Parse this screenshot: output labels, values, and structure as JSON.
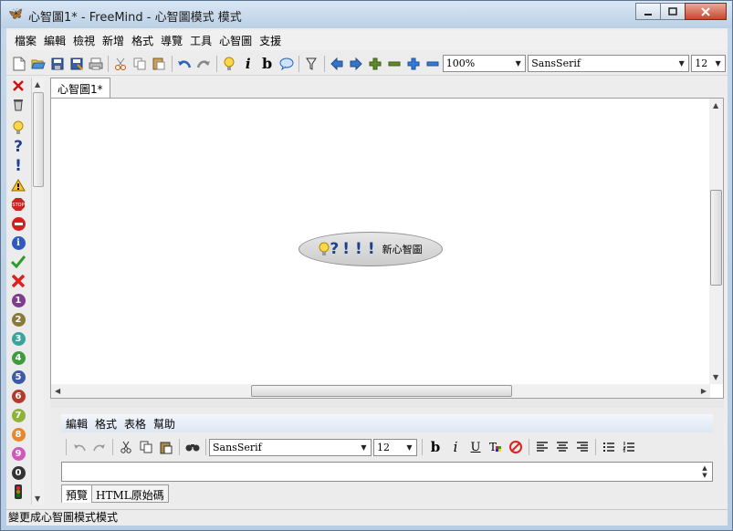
{
  "window": {
    "title": "心智圖1* - FreeMind - 心智圖模式 模式",
    "app_icon": "butterfly-icon",
    "controls": [
      "minimize",
      "maximize",
      "close"
    ]
  },
  "menubar": {
    "items": [
      "檔案",
      "編輯",
      "檢視",
      "新增",
      "格式",
      "導覽",
      "工具",
      "心智圖",
      "支援"
    ]
  },
  "toolbar": {
    "icons": [
      "new-icon",
      "open-icon",
      "save-icon",
      "save-as-icon",
      "print-icon",
      "cut-icon",
      "copy-icon",
      "paste-icon",
      "undo-icon",
      "redo-icon",
      "idea-icon",
      "italic-icon",
      "bold-icon",
      "note-icon",
      "filter-icon",
      "back-icon",
      "forward-icon",
      "plus-icon",
      "minus-icon",
      "expand-icon",
      "collapse-icon"
    ],
    "italic_label": "i",
    "bold_label": "b",
    "zoom_value": "100%",
    "font_value": "SansSerif",
    "size_value": "12"
  },
  "iconbar": {
    "icons": [
      "remove-icon",
      "trash-icon",
      "idea-icon",
      "help-icon",
      "important-icon",
      "warning-icon",
      "stop-icon",
      "no-entry-icon",
      "info-icon",
      "check-icon",
      "cross-icon",
      "priority-1-icon",
      "priority-2-icon",
      "priority-3-icon",
      "priority-4-icon",
      "priority-5-icon",
      "priority-6-icon",
      "priority-7-icon",
      "priority-8-icon",
      "priority-9-icon",
      "priority-0-icon",
      "traffic-light-icon"
    ],
    "numbers": [
      "1",
      "2",
      "3",
      "4",
      "5",
      "6",
      "7",
      "8",
      "9",
      "0"
    ],
    "stop_text": "STOP"
  },
  "tabs": {
    "active": "心智圖1*"
  },
  "map": {
    "root_node": {
      "text": "新心智圖",
      "icons": [
        "idea-icon",
        "help-icon",
        "important-icon",
        "important-icon",
        "important-icon"
      ]
    }
  },
  "notes_editor": {
    "menu": [
      "編輯",
      "格式",
      "表格",
      "幫助"
    ],
    "font_value": "SansSerif",
    "size_value": "12",
    "bold_label": "b",
    "italic_label": "i",
    "underline_label": "U",
    "tabs": [
      "預覽",
      "HTML原始碼"
    ]
  },
  "statusbar": {
    "text": "變更成心智圖模式模式"
  },
  "colors": {
    "title_gradient_top": "#d9e7f4",
    "close_button": "#c9462c",
    "node_fill": "#d9d9d9",
    "icon_blue": "#1f3f8f"
  }
}
